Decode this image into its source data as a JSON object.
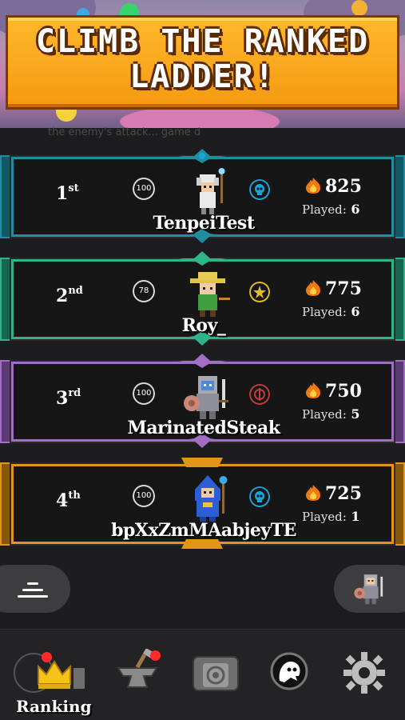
{
  "banner": {
    "title_line1": "CLIMB THE RANKED",
    "title_line2": "LADDER!",
    "behind_text": "the enemy's attack... game d"
  },
  "rows": [
    {
      "rank_number": "1",
      "rank_suffix": "st",
      "level": "100",
      "name": "TenpeiTest",
      "score": "825",
      "played_label": "Played:",
      "played_value": "6",
      "frame_color": "#1f8ea0",
      "side_color": "#0d5a66",
      "badge_color": "#1aa4d8",
      "avatar": "white-haired-mage-avatar"
    },
    {
      "rank_number": "2",
      "rank_suffix": "nd",
      "level": "78",
      "name": "Roy_",
      "score": "775",
      "played_label": "Played:",
      "played_value": "6",
      "frame_color": "#2fb489",
      "side_color": "#12684e",
      "badge_color": "#e0c21a",
      "avatar": "straw-hat-ranger-avatar"
    },
    {
      "rank_number": "3",
      "rank_suffix": "rd",
      "level": "100",
      "name": "MarinatedSteak",
      "score": "750",
      "played_label": "Played:",
      "played_value": "5",
      "frame_color": "#a16ec4",
      "side_color": "#5c3976",
      "badge_color": "#c23b3b",
      "avatar": "armored-knight-avatar"
    },
    {
      "rank_number": "4",
      "rank_suffix": "th",
      "level": "100",
      "name": "bpXxZmMAabjeyTE",
      "score": "725",
      "played_label": "Played:",
      "played_value": "1",
      "frame_color": "#e1961a",
      "side_color": "#8a5608",
      "badge_color": "#1aa4d8",
      "avatar": "blue-hooded-mage-avatar"
    }
  ],
  "controls": {
    "filter_icon": "filter-lines-icon",
    "profile_icon": "player-avatar-icon"
  },
  "nav": {
    "items": [
      {
        "label": "Ranking",
        "icon": "crown-icon",
        "active": true,
        "notification": true
      },
      {
        "label": "",
        "icon": "anvil-icon",
        "active": false,
        "notification": true
      },
      {
        "label": "",
        "icon": "portal-gate-icon",
        "active": false,
        "notification": false
      },
      {
        "label": "",
        "icon": "guild-ghost-icon",
        "active": false,
        "notification": false
      },
      {
        "label": "",
        "icon": "gear-icon",
        "active": false,
        "notification": false
      }
    ]
  },
  "colors": {
    "background": "#1d1d1f",
    "banner_orange": "#f59b12",
    "score_flame": "#f07a12",
    "notification": "#ff2b2b"
  }
}
